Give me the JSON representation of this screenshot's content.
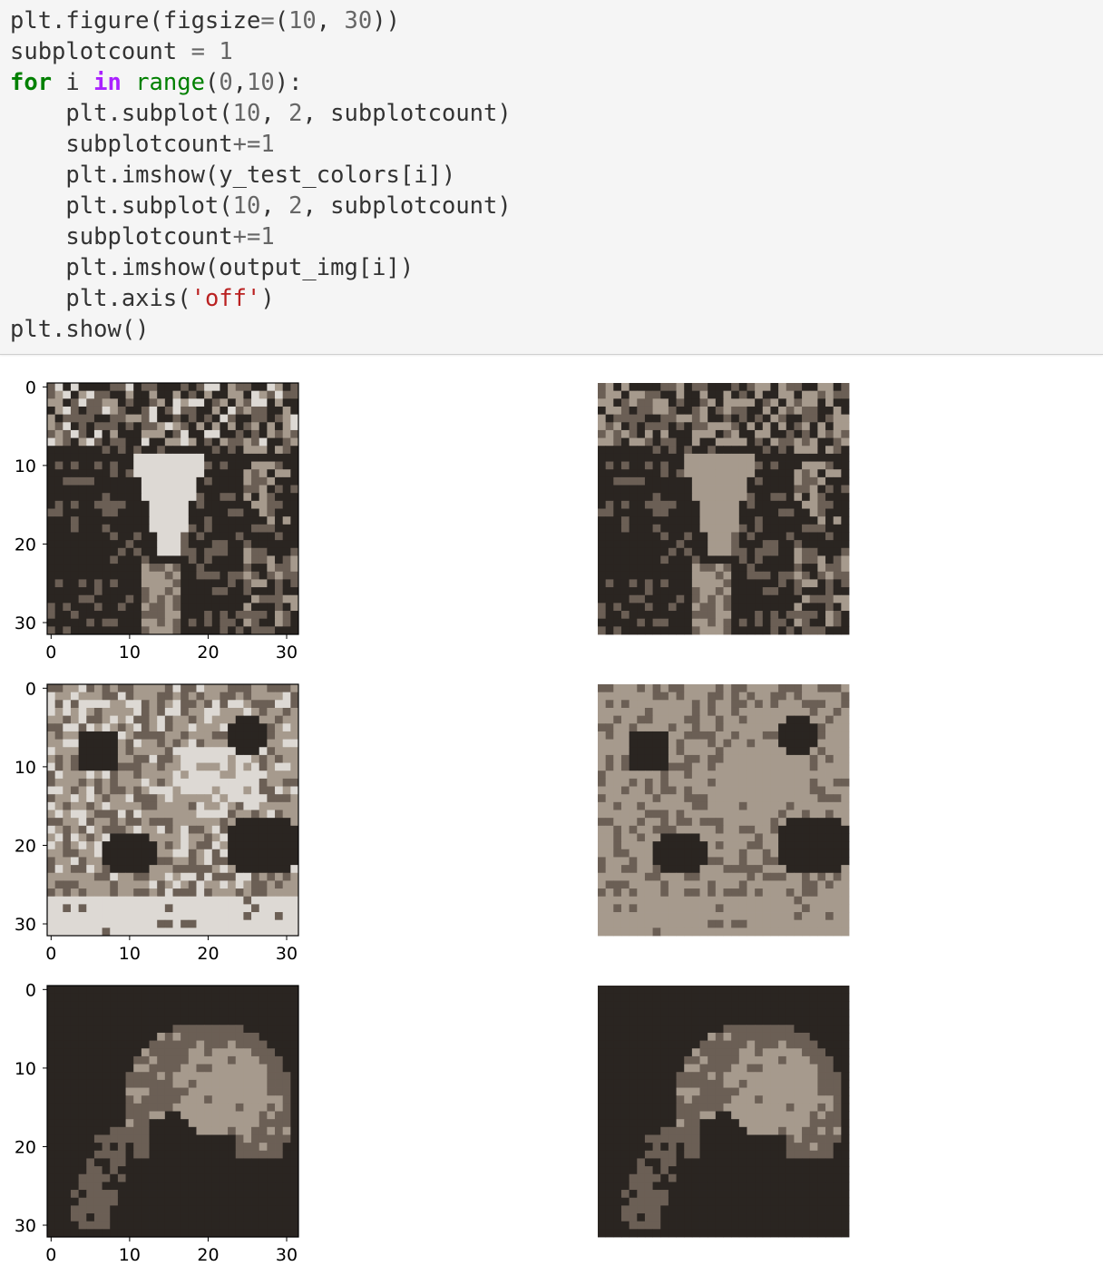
{
  "code_cell": {
    "lines": [
      [
        {
          "t": "plt.figure(figsize"
        },
        {
          "t": "=",
          "c": "eq"
        },
        {
          "t": "("
        },
        {
          "t": "10",
          "c": "num"
        },
        {
          "t": ", "
        },
        {
          "t": "30",
          "c": "num"
        },
        {
          "t": "))"
        }
      ],
      [
        {
          "t": "subplotcount "
        },
        {
          "t": "=",
          "c": "eq"
        },
        {
          "t": " "
        },
        {
          "t": "1",
          "c": "num"
        }
      ],
      [
        {
          "t": "for",
          "c": "kw"
        },
        {
          "t": " i "
        },
        {
          "t": "in",
          "c": "op-in"
        },
        {
          "t": " "
        },
        {
          "t": "range",
          "c": "bi"
        },
        {
          "t": "("
        },
        {
          "t": "0",
          "c": "num"
        },
        {
          "t": ","
        },
        {
          "t": "10",
          "c": "num"
        },
        {
          "t": "):"
        }
      ],
      [
        {
          "t": "    plt.subplot("
        },
        {
          "t": "10",
          "c": "num"
        },
        {
          "t": ", "
        },
        {
          "t": "2",
          "c": "num"
        },
        {
          "t": ", subplotcount)"
        }
      ],
      [
        {
          "t": "    subplotcount"
        },
        {
          "t": "+=",
          "c": "eq"
        },
        {
          "t": "1",
          "c": "num"
        }
      ],
      [
        {
          "t": "    plt.imshow(y_test_colors[i])"
        }
      ],
      [
        {
          "t": "    plt.subplot("
        },
        {
          "t": "10",
          "c": "num"
        },
        {
          "t": ", "
        },
        {
          "t": "2",
          "c": "num"
        },
        {
          "t": ", subplotcount)"
        }
      ],
      [
        {
          "t": "    subplotcount"
        },
        {
          "t": "+=",
          "c": "eq"
        },
        {
          "t": "1",
          "c": "num"
        }
      ],
      [
        {
          "t": "    plt.imshow(output_img[i])"
        }
      ],
      [
        {
          "t": "    plt.axis("
        },
        {
          "t": "'off'",
          "c": "str"
        },
        {
          "t": ")"
        }
      ],
      [
        {
          "t": "plt.show()"
        }
      ]
    ]
  },
  "chart_data": {
    "type": "image-grid",
    "image_size": [
      32,
      32
    ],
    "palette": {
      "dark": "#2a2521",
      "mid": "#6b5f55",
      "light": "#a69a8d",
      "bright": "#ddd9d4"
    },
    "axis_ticks": {
      "x": [
        "0",
        "10",
        "20",
        "30"
      ],
      "y": [
        "0",
        "10",
        "20",
        "30"
      ]
    },
    "rows": [
      {
        "left": {
          "axes": "on"
        },
        "right": {
          "axes": "off"
        }
      },
      {
        "left": {
          "axes": "on"
        },
        "right": {
          "axes": "off"
        }
      },
      {
        "left": {
          "axes": "on"
        },
        "right": {
          "axes": "off"
        }
      }
    ]
  }
}
